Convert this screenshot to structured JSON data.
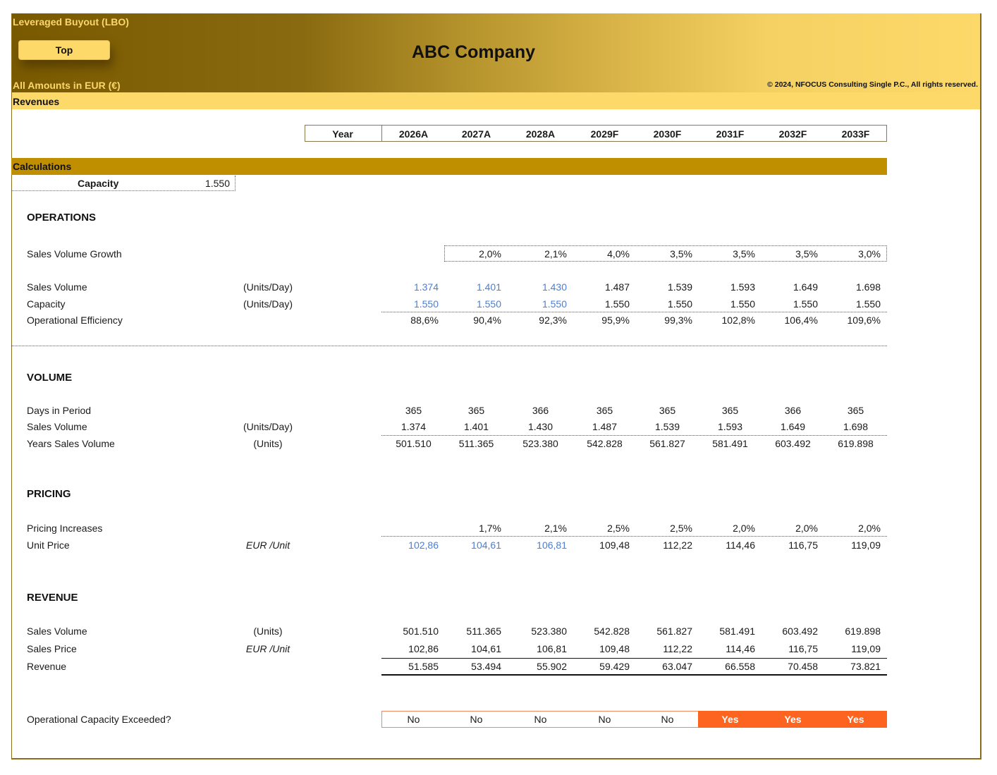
{
  "header": {
    "model_title": "Leveraged Buyout (LBO)",
    "top_button": "Top",
    "currency_note": "All Amounts in  EUR (€)",
    "company": "ABC Company",
    "copyright": "© 2024, NFOCUS Consulting Single P.C., All rights reserved.",
    "sheet_name": "Revenues"
  },
  "colors": {
    "accent": "#bf8f00",
    "banner_light": "#fdd96a",
    "banner_dark": "#7a5a00",
    "input_blue": "#4a7fd4",
    "flag_yes": "#fd6420"
  },
  "years": {
    "label": "Year",
    "columns": [
      "2026A",
      "2027A",
      "2028A",
      "2029F",
      "2030F",
      "2031F",
      "2032F",
      "2033F"
    ]
  },
  "calculations": {
    "label": "Calculations",
    "capacity_label": "Capacity",
    "capacity_value": "1.550"
  },
  "operations": {
    "title": "OPERATIONS",
    "growth": {
      "label": "Sales Volume Growth",
      "values": [
        "",
        "2,0%",
        "2,1%",
        "4,0%",
        "3,5%",
        "3,5%",
        "3,5%",
        "3,0%"
      ]
    },
    "sales_volume": {
      "label": "Sales Volume",
      "unit": "(Units/Day)",
      "values": [
        "1.374",
        "1.401",
        "1.430",
        "1.487",
        "1.539",
        "1.593",
        "1.649",
        "1.698"
      ]
    },
    "capacity": {
      "label": "Capacity",
      "unit": "(Units/Day)",
      "values": [
        "1.550",
        "1.550",
        "1.550",
        "1.550",
        "1.550",
        "1.550",
        "1.550",
        "1.550"
      ]
    },
    "efficiency": {
      "label": "Operational Efficiency",
      "values": [
        "88,6%",
        "90,4%",
        "92,3%",
        "95,9%",
        "99,3%",
        "102,8%",
        "106,4%",
        "109,6%"
      ]
    }
  },
  "volume": {
    "title": "VOLUME",
    "days": {
      "label": "Days in Period",
      "values": [
        "365",
        "365",
        "366",
        "365",
        "365",
        "365",
        "366",
        "365"
      ]
    },
    "sales_volume": {
      "label": "Sales Volume",
      "unit": "(Units/Day)",
      "values": [
        "1.374",
        "1.401",
        "1.430",
        "1.487",
        "1.539",
        "1.593",
        "1.649",
        "1.698"
      ]
    },
    "years_volume": {
      "label": "Years Sales Volume",
      "unit": "(Units)",
      "values": [
        "501.510",
        "511.365",
        "523.380",
        "542.828",
        "561.827",
        "581.491",
        "603.492",
        "619.898"
      ]
    }
  },
  "pricing": {
    "title": "PRICING",
    "increases": {
      "label": "Pricing Increases",
      "values": [
        "",
        "1,7%",
        "2,1%",
        "2,5%",
        "2,5%",
        "2,0%",
        "2,0%",
        "2,0%"
      ]
    },
    "unit_price": {
      "label": "Unit Price",
      "unit": "EUR /Unit",
      "values": [
        "102,86",
        "104,61",
        "106,81",
        "109,48",
        "112,22",
        "114,46",
        "116,75",
        "119,09"
      ]
    }
  },
  "revenue": {
    "title": "REVENUE",
    "sales_volume": {
      "label": "Sales Volume",
      "unit": "(Units)",
      "values": [
        "501.510",
        "511.365",
        "523.380",
        "542.828",
        "561.827",
        "581.491",
        "603.492",
        "619.898"
      ]
    },
    "sales_price": {
      "label": "Sales Price",
      "unit": "EUR /Unit",
      "values": [
        "102,86",
        "104,61",
        "106,81",
        "109,48",
        "112,22",
        "114,46",
        "116,75",
        "119,09"
      ]
    },
    "revenue": {
      "label": "Revenue",
      "values": [
        "51.585",
        "53.494",
        "55.902",
        "59.429",
        "63.047",
        "66.558",
        "70.458",
        "73.821"
      ]
    }
  },
  "capacity_check": {
    "label": "Operational Capacity Exceeded?",
    "values": [
      "No",
      "No",
      "No",
      "No",
      "No",
      "Yes",
      "Yes",
      "Yes"
    ]
  }
}
